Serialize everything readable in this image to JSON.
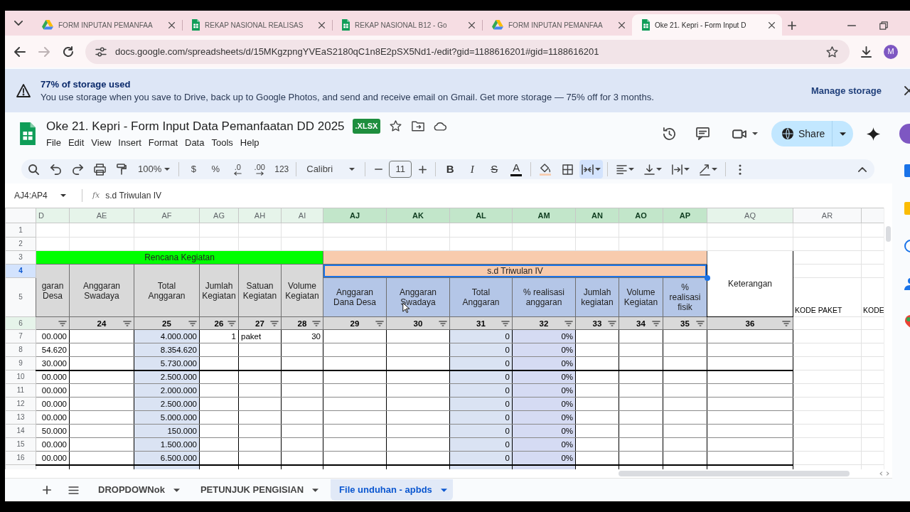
{
  "browser": {
    "tabs": [
      {
        "title": "FORM INPUTAN PEMANFAA",
        "kind": "drive",
        "selected": false
      },
      {
        "title": "REKAP NASIONAL REALISAS",
        "kind": "sheets",
        "selected": false
      },
      {
        "title": "REKAP NASIONAL B12 - Go",
        "kind": "sheets",
        "selected": false
      },
      {
        "title": "FORM INPUTAN PEMANFAA",
        "kind": "drive",
        "selected": false
      },
      {
        "title": "Oke 21. Kepri - Form Input D",
        "kind": "sheets",
        "selected": true
      }
    ],
    "can_go_forward": false,
    "url": "docs.google.com/spreadsheets/d/15MKgzpngYVEaS2180qC1n8E2pSX5Nd1-/edit?gid=1188616201#gid=1188616201",
    "profile": "M"
  },
  "storage_banner": {
    "title": "77% of storage used",
    "message": "You use storage when you save to Drive, back up to Google Photos, and send and receive email on Gmail. Get more storage — 75% off for 3 months.",
    "action": "Manage storage"
  },
  "document": {
    "title": "Oke 21. Kepri - Form Input Data Pemanfaatan DD 2025",
    "format_badge": ".XLSX",
    "menu": [
      "File",
      "Edit",
      "View",
      "Insert",
      "Format",
      "Data",
      "Tools",
      "Help"
    ],
    "share": "Share"
  },
  "toolbar": {
    "zoom": "100%",
    "currency": "$",
    "percent": "%",
    "decrease_decimals": ".0",
    "increase_decimals": ".00",
    "more_formats": "123",
    "font": "Calibri",
    "font_size": "11",
    "text_styles": [
      {
        "glyph": "B",
        "kind": "bold"
      },
      {
        "glyph": "I",
        "kind": "italic"
      },
      {
        "glyph": "S",
        "kind": "strikethrough"
      },
      {
        "glyph": "A",
        "kind": "text_color"
      }
    ],
    "merge_active": true
  },
  "formula_bar": {
    "name_box": "AJ4:AP4",
    "function_label": "fx",
    "formula": "s.d Triwulan IV"
  },
  "sheet": {
    "columns": [
      {
        "label": "D",
        "selected": false,
        "filtered": true
      },
      {
        "label": "AE",
        "selected": false,
        "filtered": true
      },
      {
        "label": "AF",
        "selected": false,
        "filtered": true
      },
      {
        "label": "AG",
        "selected": false,
        "filtered": true
      },
      {
        "label": "AH",
        "selected": false,
        "filtered": true
      },
      {
        "label": "AI",
        "selected": false,
        "filtered": true
      },
      {
        "label": "AJ",
        "selected": true,
        "filtered": true
      },
      {
        "label": "AK",
        "selected": true,
        "filtered": true
      },
      {
        "label": "AL",
        "selected": true,
        "filtered": true
      },
      {
        "label": "AM",
        "selected": true,
        "filtered": true
      },
      {
        "label": "AN",
        "selected": true,
        "filtered": true
      },
      {
        "label": "AO",
        "selected": true,
        "filtered": true
      },
      {
        "label": "AP",
        "selected": true,
        "filtered": true
      },
      {
        "label": "AQ",
        "selected": false,
        "filtered": true
      },
      {
        "label": "AR",
        "selected": false,
        "filtered": false
      },
      {
        "selected": false,
        "filtered": false
      }
    ],
    "rows": [
      {
        "label": "1",
        "selected": false,
        "filter_header": false,
        "group_end": false
      },
      {
        "label": "2",
        "selected": false,
        "filter_header": false,
        "group_end": false
      },
      {
        "label": "3",
        "selected": false,
        "filter_header": false,
        "group_end": false
      },
      {
        "label": "4",
        "selected": true,
        "filter_header": false,
        "group_end": false
      },
      {
        "label": "5",
        "selected": false,
        "filter_header": false,
        "group_end": false
      },
      {
        "label": "6",
        "selected": false,
        "filter_header": true,
        "group_end": false
      },
      {
        "label": "7",
        "selected": false,
        "filter_header": false,
        "group_end": false
      },
      {
        "label": "8",
        "selected": false,
        "filter_header": false,
        "group_end": false
      },
      {
        "label": "9",
        "selected": false,
        "filter_header": false,
        "group_end": true
      },
      {
        "label": "10",
        "selected": false,
        "filter_header": false,
        "group_end": false
      },
      {
        "label": "11",
        "selected": false,
        "filter_header": false,
        "group_end": false
      },
      {
        "label": "12",
        "selected": false,
        "filter_header": false,
        "group_end": false
      },
      {
        "label": "13",
        "selected": false,
        "filter_header": false,
        "group_end": false
      },
      {
        "label": "14",
        "selected": false,
        "filter_header": false,
        "group_end": false
      },
      {
        "label": "15",
        "selected": false,
        "filter_header": false,
        "group_end": false
      },
      {
        "label": "16",
        "selected": false,
        "filter_header": false,
        "group_end": true
      }
    ],
    "groups": [
      {
        "kind": "plan",
        "title": "Rencana Kegiatan",
        "color": "#00ff00",
        "selected": false,
        "fields": [
          {
            "heading": "garan\nDesa",
            "kind": "input",
            "filter": true,
            "values": [
              "00.000",
              "54.620",
              "30.000",
              "00.000",
              "00.000",
              "00.000",
              "00.000",
              "50.000",
              "00.000",
              "00.000"
            ]
          },
          {
            "heading": "Anggaran\nSwadaya",
            "index": "24",
            "kind": "input",
            "filter": true
          },
          {
            "heading": "Total\nAnggaran",
            "index": "25",
            "kind": "total",
            "filter": true,
            "values": [
              "4.000.000",
              "8.354.620",
              "5.730.000",
              "2.500.000",
              "2.000.000",
              "2.500.000",
              "5.000.000",
              "150.000",
              "1.500.000",
              "6.500.000"
            ]
          },
          {
            "heading": "Jumlah\nKegiatan",
            "index": "26",
            "kind": "input",
            "filter": true,
            "values": [
              "1"
            ]
          },
          {
            "heading": "Satuan\nKegiatan",
            "index": "27",
            "kind": "text",
            "filter": true,
            "values": [
              "paket"
            ]
          },
          {
            "heading": "Volume\nKegiatan",
            "index": "28",
            "kind": "input",
            "filter": true,
            "values": [
              "30"
            ]
          }
        ]
      },
      {
        "kind": "realization",
        "title": "s.d Triwulan IV",
        "color": "#f8cbad",
        "selected": true,
        "fields": [
          {
            "heading": "Anggaran\nDana Desa",
            "index": "29",
            "kind": "input",
            "filter": true
          },
          {
            "heading": "Anggaran\nSwadaya",
            "index": "30",
            "kind": "input",
            "filter": true
          },
          {
            "heading": "Total\nAnggaran",
            "index": "31",
            "kind": "total",
            "filter": true,
            "values": [
              "0",
              "0",
              "0",
              "0",
              "0",
              "0",
              "0",
              "0",
              "0",
              "0"
            ]
          },
          {
            "heading": "% realisasi\nanggaran",
            "index": "32",
            "kind": "ratio",
            "filter": true,
            "values": [
              "0%",
              "0%",
              "0%",
              "0%",
              "0%",
              "0%",
              "0%",
              "0%",
              "0%",
              "0%"
            ]
          },
          {
            "heading": "Jumlah\nkegiatan",
            "index": "33",
            "kind": "input",
            "filter": true
          },
          {
            "heading": "Volume\nKegiatan",
            "index": "34",
            "kind": "input",
            "filter": true
          },
          {
            "heading": "%\nrealisasi\nfisik",
            "index": "35",
            "kind": "input",
            "filter": true
          }
        ]
      },
      {
        "kind": "note",
        "fields": [
          {
            "heading": "Keterangan",
            "index": "36",
            "kind": "text",
            "filter": true
          }
        ]
      },
      {
        "kind": "extra",
        "fields": [
          {
            "heading": "KODE PAKET",
            "kind": "text"
          },
          {
            "heading": "KODE",
            "kind": "text"
          }
        ]
      }
    ]
  },
  "sheet_tabs": [
    {
      "label": "DROPDOWNok",
      "selected": false
    },
    {
      "label": "PETUNJUK PENGISIAN",
      "selected": false
    },
    {
      "label": "File unduhan - apbds",
      "selected": true
    }
  ]
}
